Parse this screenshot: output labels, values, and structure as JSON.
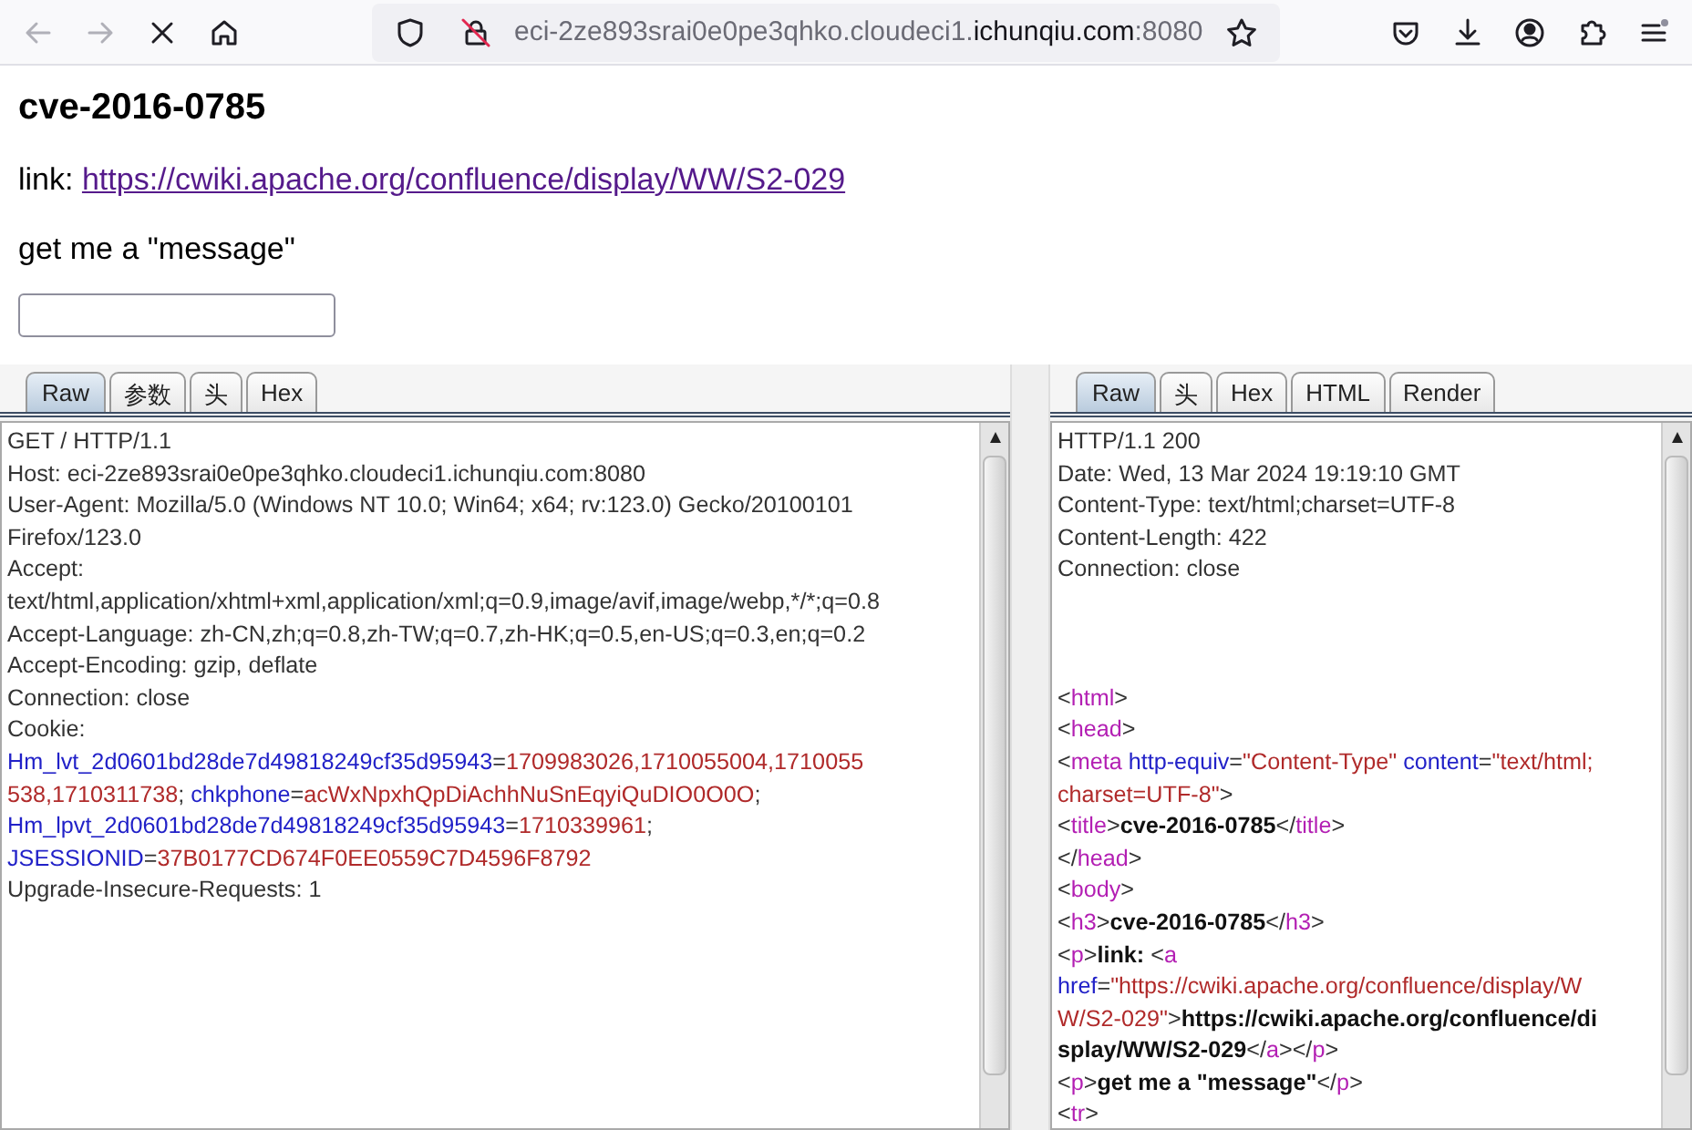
{
  "toolbar": {
    "back_disabled": true,
    "forward_disabled": true,
    "url": {
      "prefix": "eci-2ze893srai0e0pe3qhko.cloudeci1.",
      "domain": "ichunqiu.com",
      "suffix": ":8080"
    }
  },
  "page": {
    "heading": "cve-2016-0785",
    "link_label": "link: ",
    "link": "https://cwiki.apache.org/confluence/display/WW/S2-029",
    "prompt": "get me a \"message\""
  },
  "request": {
    "tabs": [
      {
        "label": "Raw",
        "selected": true
      },
      {
        "label": "参数",
        "selected": false
      },
      {
        "label": "头",
        "selected": false
      },
      {
        "label": "Hex",
        "selected": false
      }
    ],
    "lines": [
      {
        "segments": [
          {
            "kind": "plain",
            "text": "GET / HTTP/1.1"
          }
        ]
      },
      {
        "segments": [
          {
            "kind": "plain",
            "text": "Host: eci-2ze893srai0e0pe3qhko.cloudeci1.ichunqiu.com:8080"
          }
        ]
      },
      {
        "segments": [
          {
            "kind": "plain",
            "text": "User-Agent: Mozilla/5.0 (Windows NT 10.0; Win64; x64; rv:123.0) Gecko/20100101"
          }
        ]
      },
      {
        "segments": [
          {
            "kind": "plain",
            "text": "Firefox/123.0"
          }
        ]
      },
      {
        "segments": [
          {
            "kind": "plain",
            "text": "Accept:"
          }
        ]
      },
      {
        "segments": [
          {
            "kind": "plain",
            "text": "text/html,application/xhtml+xml,application/xml;q=0.9,image/avif,image/webp,*/*;q=0.8"
          }
        ]
      },
      {
        "segments": [
          {
            "kind": "plain",
            "text": "Accept-Language: zh-CN,zh;q=0.8,zh-TW;q=0.7,zh-HK;q=0.5,en-US;q=0.3,en;q=0.2"
          }
        ]
      },
      {
        "segments": [
          {
            "kind": "plain",
            "text": "Accept-Encoding: gzip, deflate"
          }
        ]
      },
      {
        "segments": [
          {
            "kind": "plain",
            "text": "Connection: close"
          }
        ]
      },
      {
        "segments": [
          {
            "kind": "plain",
            "text": "Cookie:"
          }
        ]
      },
      {
        "segments": [
          {
            "kind": "key",
            "text": "Hm_lvt_2d0601bd28de7d49818249cf35d95943"
          },
          {
            "kind": "plain",
            "text": "="
          },
          {
            "kind": "value",
            "text": "1709983026,1710055004,1710055"
          }
        ]
      },
      {
        "segments": [
          {
            "kind": "value",
            "text": "538,1710311738"
          },
          {
            "kind": "plain",
            "text": "; "
          },
          {
            "kind": "key",
            "text": "chkphone"
          },
          {
            "kind": "plain",
            "text": "="
          },
          {
            "kind": "value",
            "text": "acWxNpxhQpDiAchhNuSnEqyiQuDIO0O0O"
          },
          {
            "kind": "plain",
            "text": ";"
          }
        ]
      },
      {
        "segments": [
          {
            "kind": "key",
            "text": "Hm_lpvt_2d0601bd28de7d49818249cf35d95943"
          },
          {
            "kind": "plain",
            "text": "="
          },
          {
            "kind": "value",
            "text": "1710339961"
          },
          {
            "kind": "plain",
            "text": ";"
          }
        ]
      },
      {
        "segments": [
          {
            "kind": "key",
            "text": "JSESSIONID"
          },
          {
            "kind": "plain",
            "text": "="
          },
          {
            "kind": "value",
            "text": "37B0177CD674F0EE0559C7D4596F8792"
          }
        ]
      },
      {
        "segments": [
          {
            "kind": "plain",
            "text": "Upgrade-Insecure-Requests: 1"
          }
        ]
      }
    ]
  },
  "response": {
    "tabs": [
      {
        "label": "Raw",
        "selected": true
      },
      {
        "label": "头",
        "selected": false
      },
      {
        "label": "Hex",
        "selected": false
      },
      {
        "label": "HTML",
        "selected": false
      },
      {
        "label": "Render",
        "selected": false
      }
    ],
    "lines": [
      {
        "segments": [
          {
            "kind": "plain",
            "text": "HTTP/1.1 200"
          }
        ]
      },
      {
        "segments": [
          {
            "kind": "plain",
            "text": "Date: Wed, 13 Mar 2024 19:19:10 GMT"
          }
        ]
      },
      {
        "segments": [
          {
            "kind": "plain",
            "text": "Content-Type: text/html;charset=UTF-8"
          }
        ]
      },
      {
        "segments": [
          {
            "kind": "plain",
            "text": "Content-Length: 422"
          }
        ]
      },
      {
        "segments": [
          {
            "kind": "plain",
            "text": "Connection: close"
          }
        ]
      },
      {
        "kind": "blank"
      },
      {
        "kind": "blank"
      },
      {
        "kind": "blank"
      },
      {
        "segments": [
          {
            "kind": "plain",
            "text": "<"
          },
          {
            "kind": "tag",
            "text": "html"
          },
          {
            "kind": "plain",
            "text": ">"
          }
        ]
      },
      {
        "segments": [
          {
            "kind": "plain",
            "text": "<"
          },
          {
            "kind": "tag",
            "text": "head"
          },
          {
            "kind": "plain",
            "text": ">"
          }
        ]
      },
      {
        "segments": [
          {
            "kind": "plain",
            "text": "<"
          },
          {
            "kind": "tag",
            "text": "meta"
          },
          {
            "kind": "attr",
            "text": " http-equiv"
          },
          {
            "kind": "plain",
            "text": "="
          },
          {
            "kind": "value",
            "text": "\"Content-Type\""
          },
          {
            "kind": "attr",
            "text": " content"
          },
          {
            "kind": "plain",
            "text": "="
          },
          {
            "kind": "value",
            "text": "\"text/html;"
          }
        ]
      },
      {
        "segments": [
          {
            "kind": "value",
            "text": "charset=UTF-8\""
          },
          {
            "kind": "plain",
            "text": ">"
          }
        ]
      },
      {
        "segments": [
          {
            "kind": "plain",
            "text": "<"
          },
          {
            "kind": "tag",
            "text": "title"
          },
          {
            "kind": "plain",
            "text": ">"
          },
          {
            "kind": "bold",
            "text": "cve-2016-0785"
          },
          {
            "kind": "plain",
            "text": "</"
          },
          {
            "kind": "tag",
            "text": "title"
          },
          {
            "kind": "plain",
            "text": ">"
          }
        ]
      },
      {
        "segments": [
          {
            "kind": "plain",
            "text": "</"
          },
          {
            "kind": "tag",
            "text": "head"
          },
          {
            "kind": "plain",
            "text": ">"
          }
        ]
      },
      {
        "segments": [
          {
            "kind": "plain",
            "text": "<"
          },
          {
            "kind": "tag",
            "text": "body"
          },
          {
            "kind": "plain",
            "text": ">"
          }
        ]
      },
      {
        "segments": [
          {
            "kind": "plain",
            "text": "<"
          },
          {
            "kind": "tag",
            "text": "h3"
          },
          {
            "kind": "plain",
            "text": ">"
          },
          {
            "kind": "bold",
            "text": "cve-2016-0785"
          },
          {
            "kind": "plain",
            "text": "</"
          },
          {
            "kind": "tag",
            "text": "h3"
          },
          {
            "kind": "plain",
            "text": ">"
          }
        ]
      },
      {
        "segments": [
          {
            "kind": "plain",
            "text": "<"
          },
          {
            "kind": "tag",
            "text": "p"
          },
          {
            "kind": "plain",
            "text": ">"
          },
          {
            "kind": "bold",
            "text": "link: "
          },
          {
            "kind": "plain",
            "text": "<"
          },
          {
            "kind": "tag",
            "text": "a"
          }
        ]
      },
      {
        "segments": [
          {
            "kind": "attr",
            "text": "href"
          },
          {
            "kind": "plain",
            "text": "="
          },
          {
            "kind": "value",
            "text": "\"https://cwiki.apache.org/confluence/display/W"
          }
        ]
      },
      {
        "segments": [
          {
            "kind": "value",
            "text": "W/S2-029\""
          },
          {
            "kind": "plain",
            "text": ">"
          },
          {
            "kind": "bold",
            "text": "https://cwiki.apache.org/confluence/di"
          }
        ]
      },
      {
        "segments": [
          {
            "kind": "bold",
            "text": "splay/WW/S2-029"
          },
          {
            "kind": "plain",
            "text": "</"
          },
          {
            "kind": "tag",
            "text": "a"
          },
          {
            "kind": "plain",
            "text": "></"
          },
          {
            "kind": "tag",
            "text": "p"
          },
          {
            "kind": "plain",
            "text": ">"
          }
        ]
      },
      {
        "segments": [
          {
            "kind": "plain",
            "text": "<"
          },
          {
            "kind": "tag",
            "text": "p"
          },
          {
            "kind": "plain",
            "text": ">"
          },
          {
            "kind": "bold",
            "text": "get me a \"message\""
          },
          {
            "kind": "plain",
            "text": "</"
          },
          {
            "kind": "tag",
            "text": "p"
          },
          {
            "kind": "plain",
            "text": ">"
          }
        ]
      },
      {
        "segments": [
          {
            "kind": "plain",
            "text": "<"
          },
          {
            "kind": "tag",
            "text": "tr"
          },
          {
            "kind": "plain",
            "text": ">"
          }
        ]
      }
    ]
  }
}
